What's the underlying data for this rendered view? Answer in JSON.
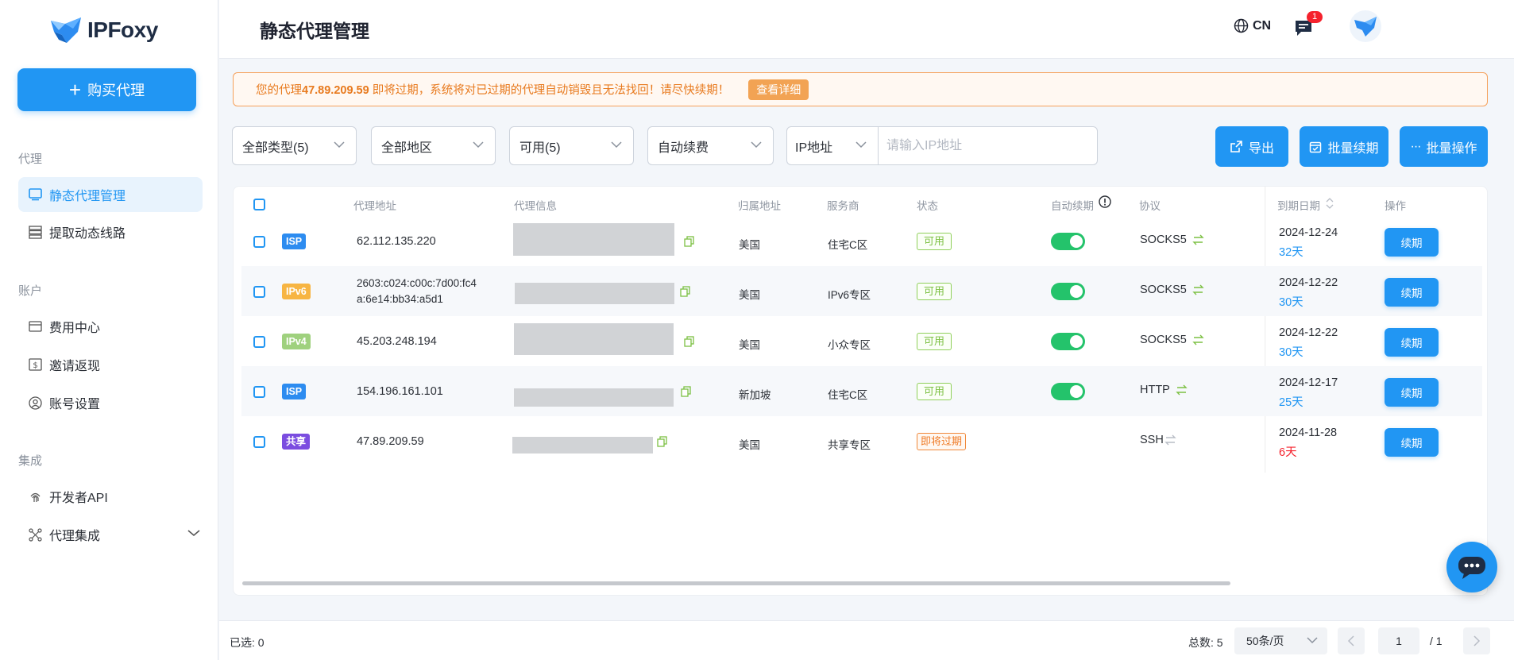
{
  "sidebar": {
    "brand": "IPFoxy",
    "buy_button": "购买代理",
    "sections": {
      "proxy": "代理",
      "account": "账户",
      "integration": "集成"
    },
    "items": [
      {
        "label": "静态代理管理",
        "icon": "monitor-icon",
        "active": true
      },
      {
        "label": "提取动态线路",
        "icon": "server-stack-icon"
      },
      {
        "label": "费用中心",
        "icon": "credit-card-icon"
      },
      {
        "label": "邀请返现",
        "icon": "dollar-icon"
      },
      {
        "label": "账号设置",
        "icon": "user-circle-icon"
      },
      {
        "label": "开发者API",
        "icon": "fingerprint-icon"
      },
      {
        "label": "代理集成",
        "icon": "network-icon"
      }
    ]
  },
  "header": {
    "title": "静态代理管理",
    "language": "CN",
    "notification_count": "1"
  },
  "alert": {
    "prefix": "您的代理",
    "ip": "47.89.209.59",
    "suffix": " 即将过期，系统将对已过期的代理自动销毁且无法找回！请尽快续期！",
    "button": "查看详细"
  },
  "filters": {
    "type": "全部类型(5)",
    "region": "全部地区",
    "status": "可用(5)",
    "renew": "自动续费",
    "ip_type": "IP地址",
    "ip_placeholder": "请输入IP地址"
  },
  "toolbar": {
    "export": "导出",
    "batch_renew": "批量续期",
    "batch_ops": "批量操作"
  },
  "table": {
    "columns": [
      "代理地址",
      "代理信息",
      "归属地址",
      "服务商",
      "状态",
      "自动续期",
      "协议",
      "到期日期",
      "操作"
    ],
    "rows": [
      {
        "tag": "ISP",
        "tag_color": "#2d8cf0",
        "ip1": "62.112.135.220",
        "ip2": "",
        "location": "美国",
        "provider": "住宅C区",
        "status": "可用",
        "status_type": "ok",
        "auto_renew": true,
        "protocol": "SOCKS5",
        "date": "2024-12-24",
        "days": "32天",
        "days_red": false,
        "action": "续期"
      },
      {
        "tag": "IPv6",
        "tag_color": "#f7b543",
        "ip1": "2603:c024:c00c:7d00:fc4",
        "ip2": "a:6e14:bb34:a5d1",
        "location": "美国",
        "provider": "IPv6专区",
        "status": "可用",
        "status_type": "ok",
        "auto_renew": true,
        "protocol": "SOCKS5",
        "date": "2024-12-22",
        "days": "30天",
        "days_red": false,
        "action": "续期"
      },
      {
        "tag": "IPv4",
        "tag_color": "#9fd17e",
        "ip1": "45.203.248.194",
        "ip2": "",
        "location": "美国",
        "provider": "小众专区",
        "status": "可用",
        "status_type": "ok",
        "auto_renew": true,
        "protocol": "SOCKS5",
        "date": "2024-12-22",
        "days": "30天",
        "days_red": false,
        "action": "续期"
      },
      {
        "tag": "ISP",
        "tag_color": "#2d8cf0",
        "ip1": "154.196.161.101",
        "ip2": "",
        "location": "新加坡",
        "provider": "住宅C区",
        "status": "可用",
        "status_type": "ok",
        "auto_renew": true,
        "protocol": "HTTP",
        "date": "2024-12-17",
        "days": "25天",
        "days_red": false,
        "action": "续期"
      },
      {
        "tag": "共享",
        "tag_color": "#7b4de0",
        "ip1": "47.89.209.59",
        "ip2": "",
        "location": "美国",
        "provider": "共享专区",
        "status": "即将过期",
        "status_type": "warn",
        "auto_renew": false,
        "protocol": "SSH",
        "date": "2024-11-28",
        "days": "6天",
        "days_red": true,
        "action": "续期"
      }
    ]
  },
  "footer": {
    "selected": "已选: 0",
    "total": "总数: 5",
    "page_size": "50条/页",
    "page": "1",
    "page_of": "/ 1"
  },
  "colors": {
    "accent": "#2196f3",
    "alert": "#e87a1e",
    "success": "#24c36b",
    "danger": "#f5222d"
  }
}
